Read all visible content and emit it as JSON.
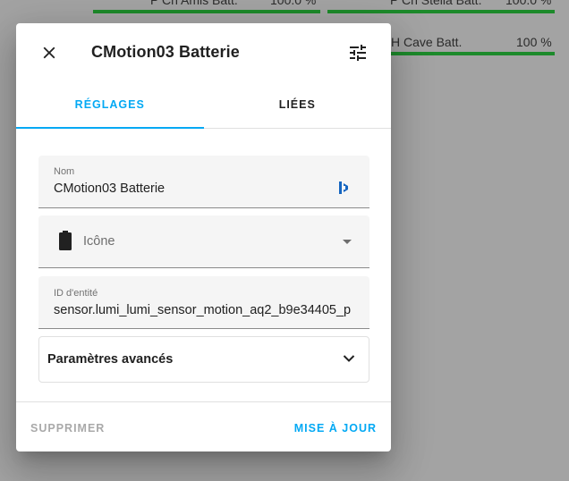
{
  "background": {
    "cards": [
      {
        "name": "P Ch Amis Batt.",
        "value": "100.0 %"
      },
      {
        "name": "P Ch Stella Batt.",
        "value": "100.0 %"
      },
      {
        "name": "H Cave Batt.",
        "value": "100 %"
      }
    ]
  },
  "dialog": {
    "title": "CMotion03 Batterie",
    "close_icon": "close-icon",
    "settings_icon": "tune-icon",
    "tabs": [
      {
        "label": "RÉGLAGES",
        "active": true
      },
      {
        "label": "LIÉES",
        "active": false
      }
    ],
    "fields": {
      "name": {
        "label": "Nom",
        "value": "CMotion03 Batterie",
        "icon": "voice-assistant-icon"
      },
      "icon": {
        "placeholder": "Icône",
        "icon": "battery-icon"
      },
      "entity_id": {
        "label": "ID d'entité",
        "value": "sensor.lumi_lumi_sensor_motion_aq2_b9e34405_p"
      }
    },
    "advanced": {
      "label": "Paramètres avancés"
    },
    "buttons": {
      "delete": "SUPPRIMER",
      "update": "MISE À JOUR"
    }
  },
  "colors": {
    "accent": "#03a9f4",
    "battery_bar": "#1d8a2b",
    "overlay": "#a3a3a3"
  }
}
